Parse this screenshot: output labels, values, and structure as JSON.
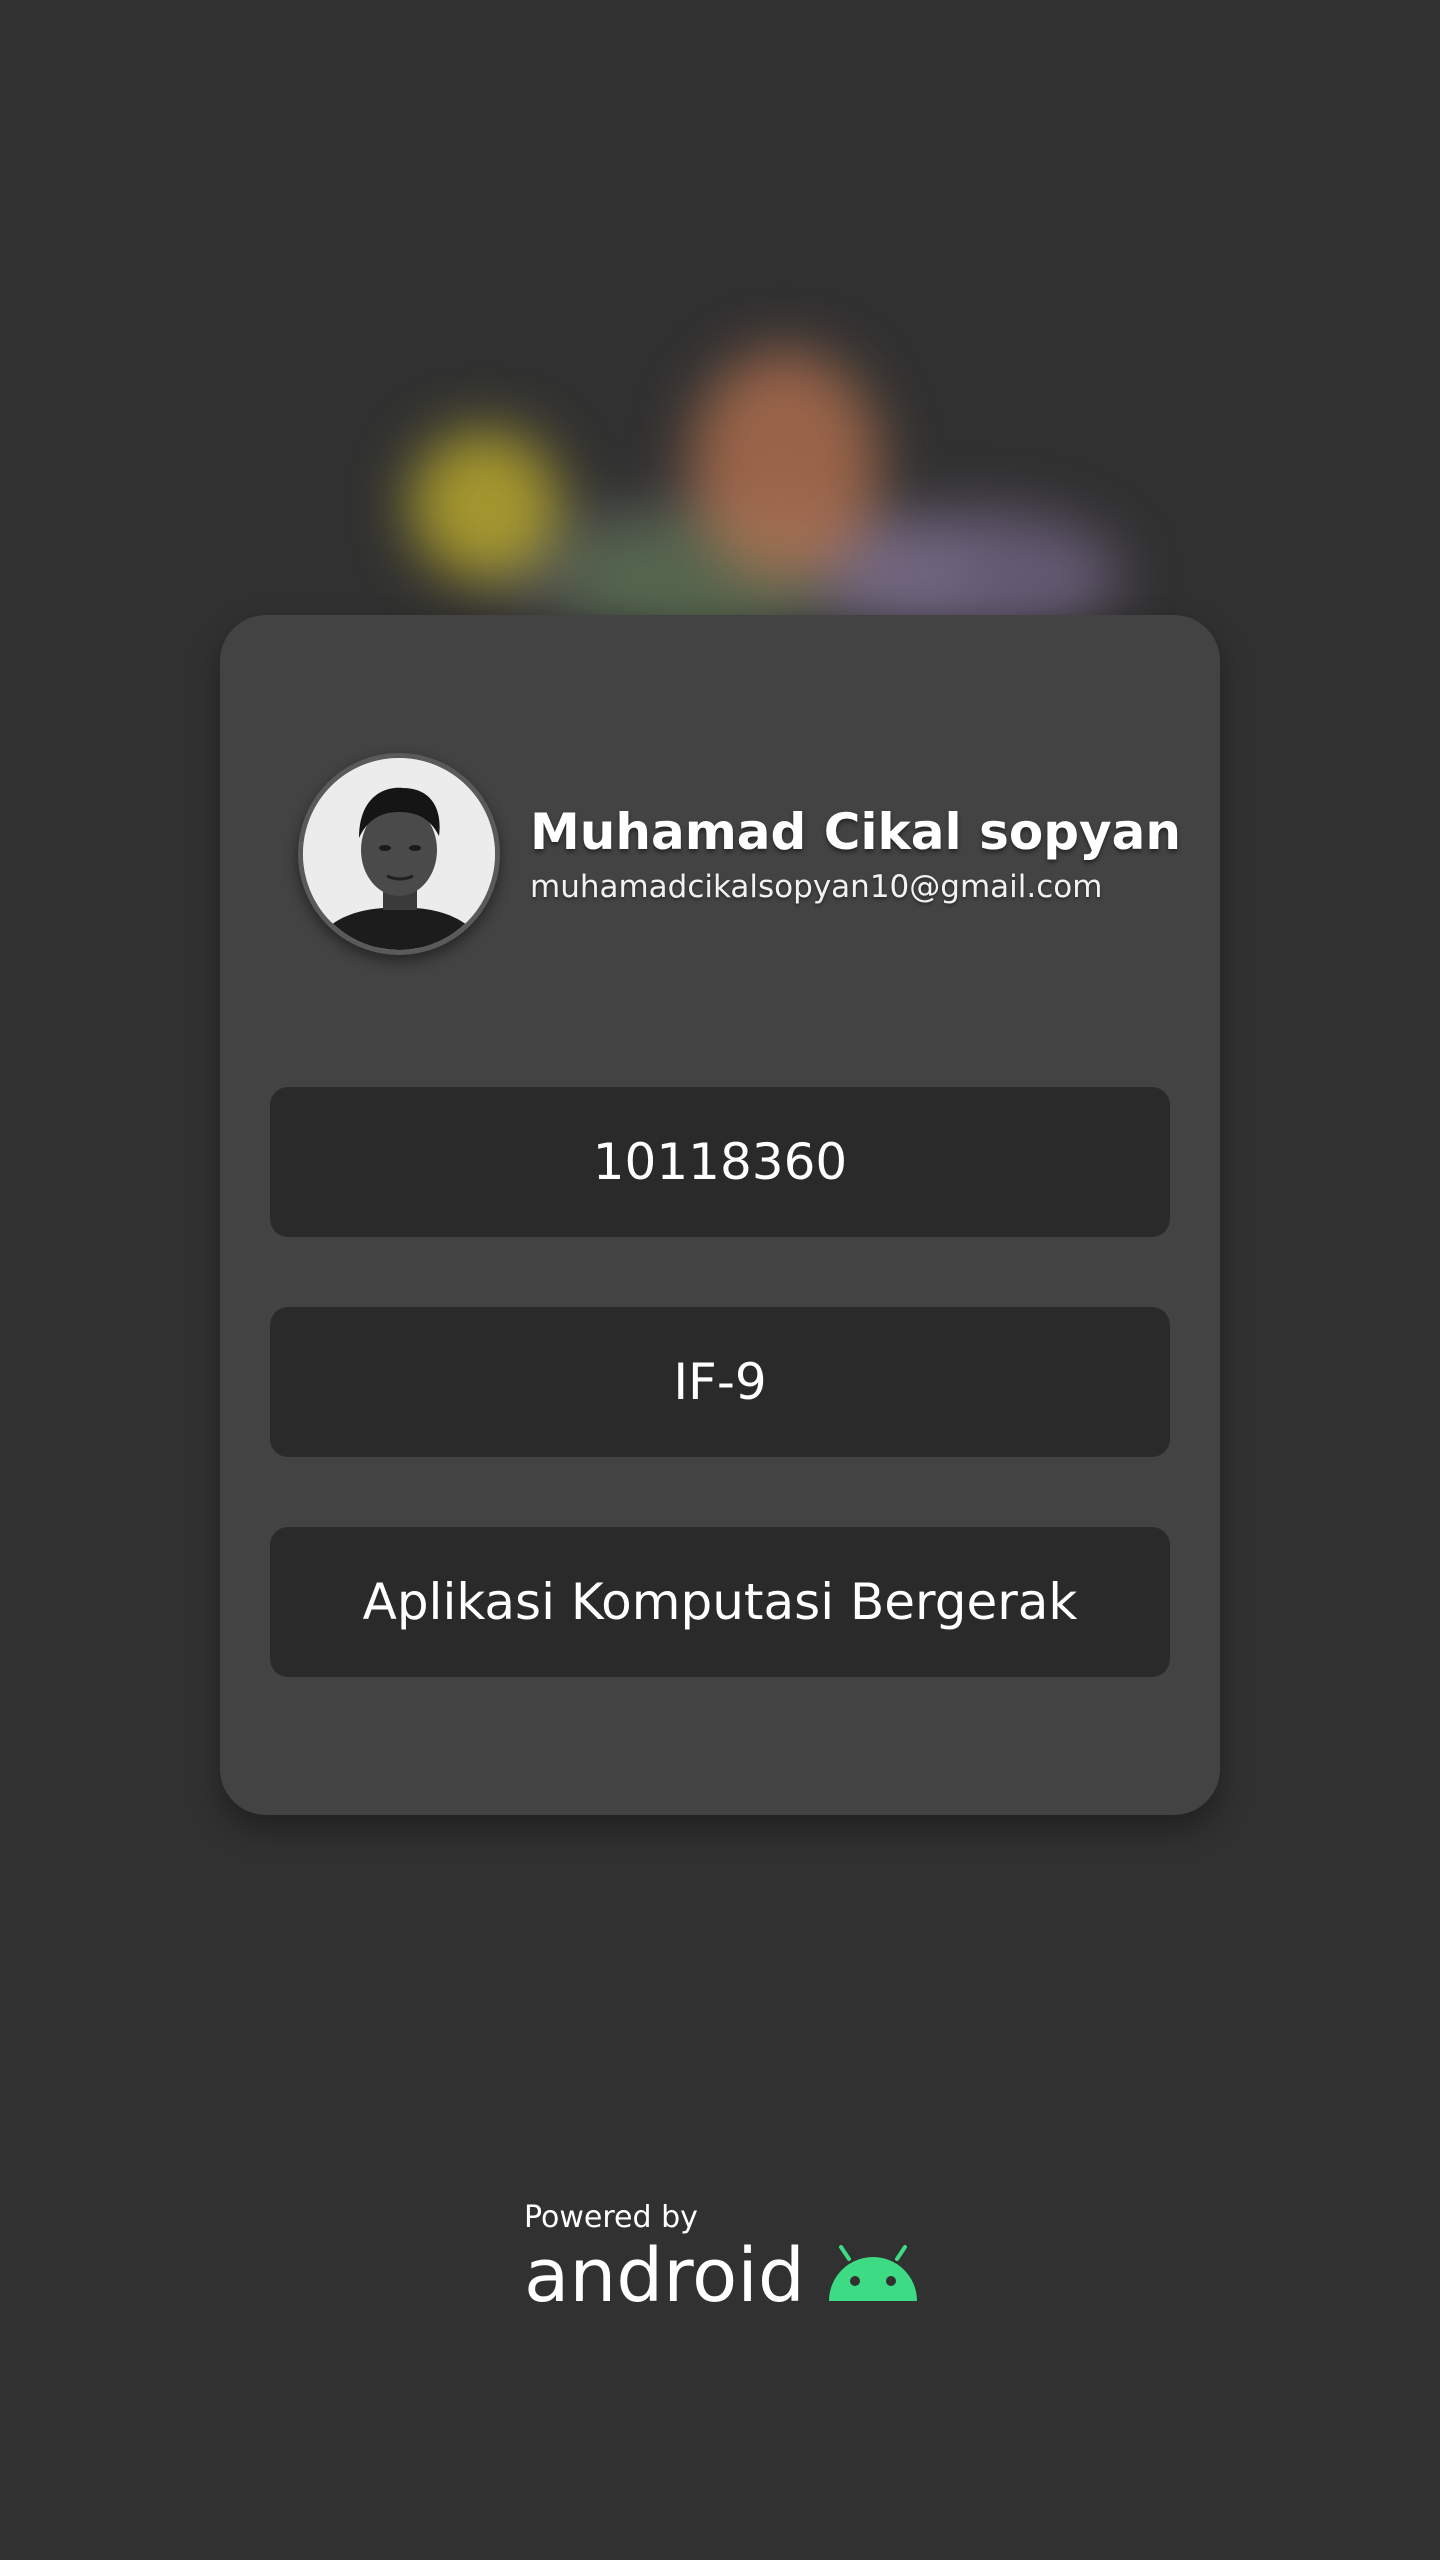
{
  "profile": {
    "name": "Muhamad Cikal sopyan",
    "email": "muhamadcikalsopyan10@gmail.com"
  },
  "fields": {
    "nim": "10118360",
    "class": "IF-9",
    "course": "Aplikasi Komputasi Bergerak"
  },
  "footer": {
    "powered_by": "Powered by",
    "brand": "android",
    "brand_icon": "android-robot-icon"
  },
  "colors": {
    "background": "#313131",
    "card": "#434343",
    "field": "#2a2a2a",
    "android_green": "#3ddc84"
  }
}
